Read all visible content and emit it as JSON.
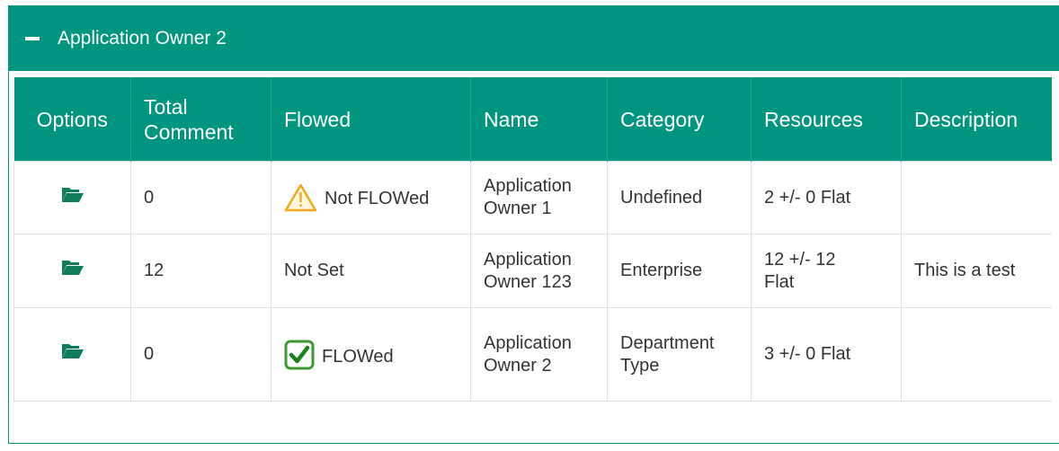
{
  "panel": {
    "title": "Application Owner 2",
    "accent_color": "#00957f"
  },
  "table": {
    "headers": {
      "options": "Options",
      "total_comment_1": "Total",
      "total_comment_2": "Comment",
      "flowed": "Flowed",
      "name": "Name",
      "category": "Category",
      "resources": "Resources",
      "description": "Description"
    },
    "rows": [
      {
        "total_comment": "0",
        "flowed": "Not FLOWed",
        "flowed_icon": "warning-icon",
        "name_1": "Application",
        "name_2": "Owner 1",
        "category_1": "Undefined",
        "category_2": "",
        "resources_1": "2 +/- 0 Flat",
        "resources_2": "",
        "description": ""
      },
      {
        "total_comment": "12",
        "flowed": "Not Set",
        "flowed_icon": "",
        "name_1": "Application",
        "name_2": "Owner 123",
        "category_1": "Enterprise",
        "category_2": "",
        "resources_1": "12 +/- 12",
        "resources_2": "Flat",
        "description": "This is a test"
      },
      {
        "total_comment": "0",
        "flowed": "FLOWed",
        "flowed_icon": "checkbox-checked-icon",
        "name_1": "Application",
        "name_2": "Owner 2",
        "category_1": "Department",
        "category_2": "Type",
        "resources_1": "3 +/- 0 Flat",
        "resources_2": "",
        "description": ""
      }
    ]
  }
}
